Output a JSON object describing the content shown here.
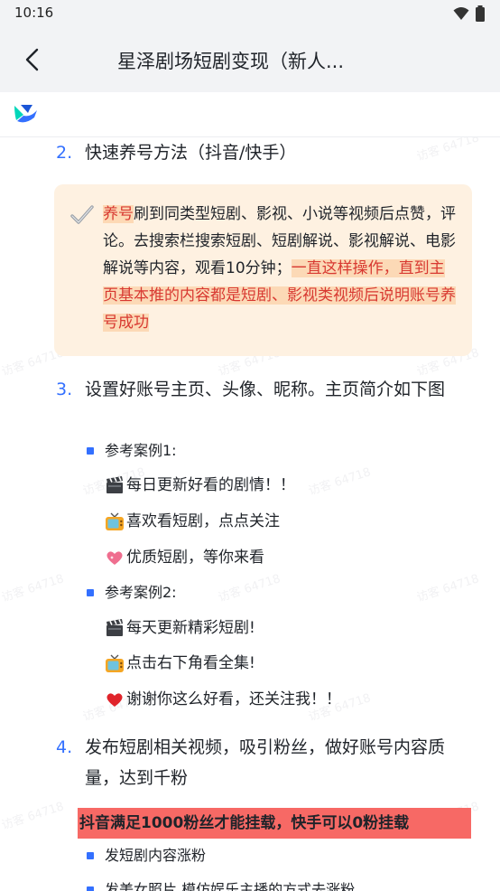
{
  "status_bar": {
    "time": "10:16"
  },
  "header": {
    "title": "星泽剧场短剧变现（新人..."
  },
  "watermark": {
    "text": "访客 64718"
  },
  "items": [
    {
      "num": "2.",
      "text": "快速养号方法（抖音/快手）"
    },
    {
      "num": "3.",
      "text": "设置好账号主页、头像、昵称。主页简介如下图"
    },
    {
      "num": "4.",
      "text": "发布短剧相关视频，吸引粉丝，做好账号内容质量，达到千粉"
    }
  ],
  "callout": {
    "part1": "养号",
    "part2": "刷到同类型短剧、影视、小说等视频后点赞，评论。去搜索栏搜索短剧、短剧解说、影视解说、电影解说等内容，观看10分钟；",
    "part3": "一直这样操作，直到主页基本推的内容都是短剧、影视类视频后说明账号养号成功"
  },
  "examples": [
    {
      "label": "参考案例1:",
      "lines": [
        {
          "icon": "clapperboard-icon",
          "text": "每日更新好看的剧情！！"
        },
        {
          "icon": "tv-icon",
          "text": "喜欢看短剧，点点关注"
        },
        {
          "icon": "sparkling-heart-icon",
          "text": "优质短剧，等你来看"
        }
      ]
    },
    {
      "label": "参考案例2:",
      "lines": [
        {
          "icon": "clapperboard-icon",
          "text": "每天更新精彩短剧!"
        },
        {
          "icon": "tv-icon",
          "text": "点击右下角看全集!"
        },
        {
          "icon": "red-heart-icon",
          "text": "谢谢你这么好看，还关注我！！"
        }
      ]
    }
  ],
  "banner": {
    "text": "抖音满足1000粉丝才能挂载，快手可以0粉挂载"
  },
  "bullets": [
    {
      "text": "发短剧内容涨粉"
    },
    {
      "text": "发美女照片 模仿娱乐主播的方式去涨粉"
    }
  ],
  "colors": {
    "accent": "#3370ff",
    "callout_bg": "#fef1e1",
    "highlight_red": "#d83931",
    "banner_bg": "#f76965"
  }
}
